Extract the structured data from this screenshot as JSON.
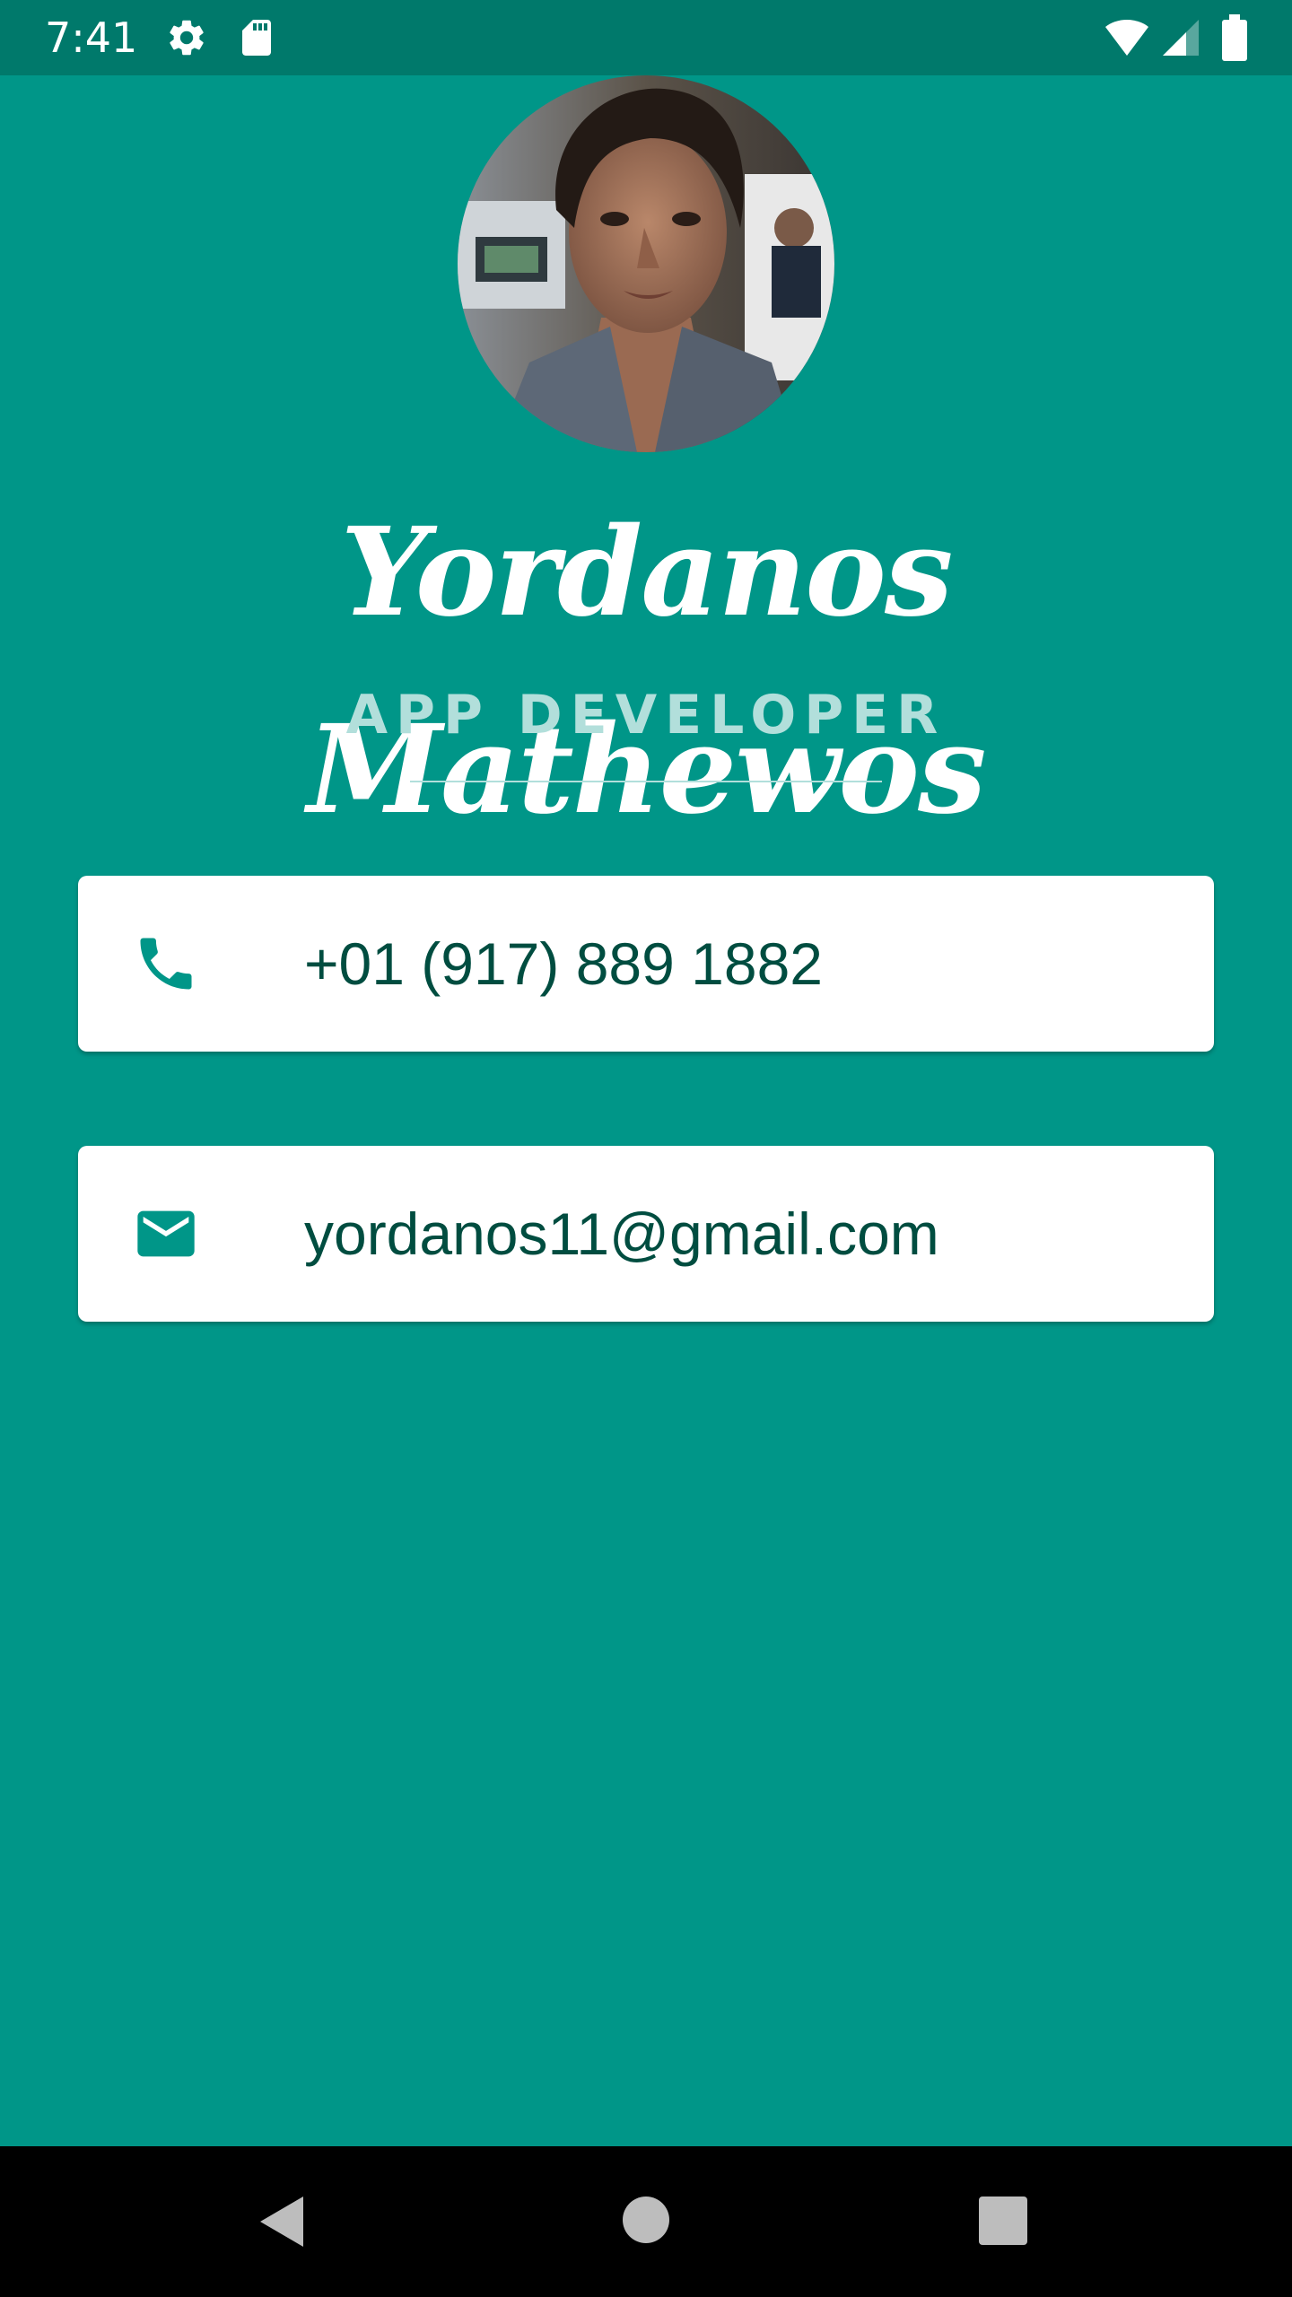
{
  "status_bar": {
    "time": "7:41",
    "icons": [
      "settings-gear-icon",
      "sd-card-icon",
      "wifi-icon",
      "cell-signal-icon",
      "battery-icon"
    ]
  },
  "profile": {
    "name": "Yordanos Mathewos",
    "title": "APP DEVELOPER",
    "avatar": "profile-photo"
  },
  "contacts": {
    "phone": {
      "icon": "phone-icon",
      "value": "+01 (917) 889 1882"
    },
    "email": {
      "icon": "mail-icon",
      "value": "yordanos11@gmail.com"
    }
  },
  "nav_bar": {
    "buttons": [
      "back-icon",
      "home-icon",
      "recents-icon"
    ]
  },
  "colors": {
    "background": "#009688",
    "status_bar": "#00796B",
    "title_text": "#B2DFDB",
    "card_text": "#004D40",
    "icon": "#009688"
  }
}
